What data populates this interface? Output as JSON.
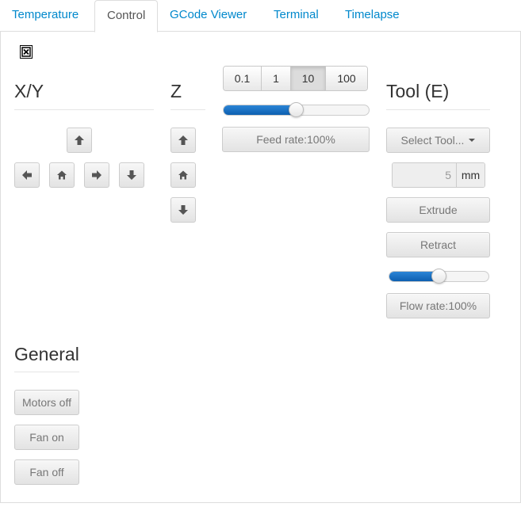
{
  "tabs": [
    {
      "label": "Temperature"
    },
    {
      "label": "Control"
    },
    {
      "label": "GCode Viewer"
    },
    {
      "label": "Terminal"
    },
    {
      "label": "Timelapse"
    }
  ],
  "active_tab": "Control",
  "sections": {
    "xy": {
      "title": "X/Y"
    },
    "z": {
      "title": "Z"
    },
    "tool": {
      "title": "Tool (E)"
    },
    "general": {
      "title": "General"
    }
  },
  "jog_distances": [
    {
      "label": "0.1"
    },
    {
      "label": "1"
    },
    {
      "label": "10"
    },
    {
      "label": "100"
    }
  ],
  "selected_jog_distance": "10",
  "feed_rate": {
    "label": "Feed rate:100%",
    "slider_fraction": 0.5
  },
  "tool": {
    "select_label": "Select Tool...",
    "extrude_amount": "5",
    "unit": "mm",
    "extrude_label": "Extrude",
    "retract_label": "Retract"
  },
  "flow_rate": {
    "label": "Flow rate:100%",
    "slider_fraction": 0.5
  },
  "general": {
    "motors_off_label": "Motors off",
    "fan_on_label": "Fan on",
    "fan_off_label": "Fan off"
  },
  "icons": {
    "webcam_toggle": "x-square-icon",
    "up": "arrow-up-icon",
    "down": "arrow-down-icon",
    "left": "arrow-left-icon",
    "right": "arrow-right-icon",
    "home": "home-icon"
  },
  "colors": {
    "link": "#0088cc",
    "slider_fill": "#1a6fc4"
  }
}
